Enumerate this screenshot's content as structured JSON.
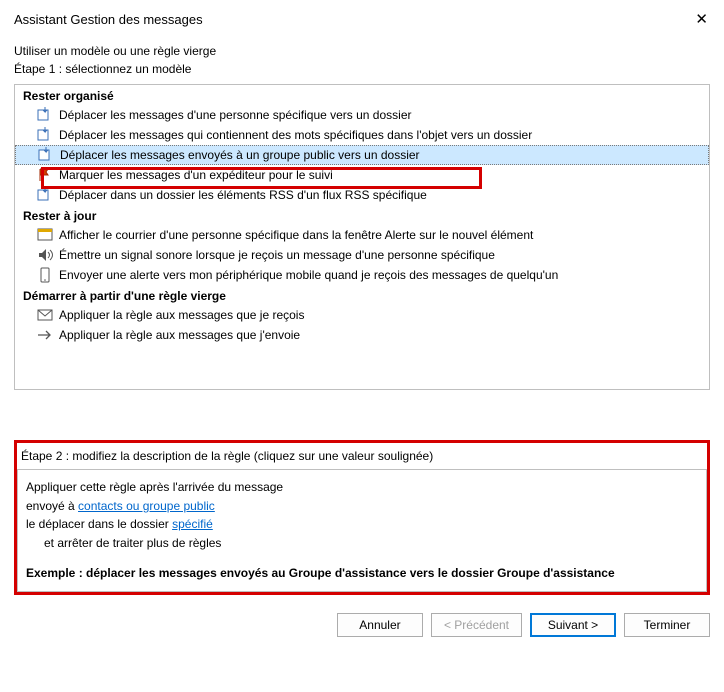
{
  "window": {
    "title": "Assistant Gestion des messages"
  },
  "intro": {
    "line1": "Utiliser un modèle ou une règle vierge",
    "line2": "Étape 1 : sélectionnez un modèle"
  },
  "sections": {
    "organised": {
      "title": "Rester organisé",
      "items": [
        "Déplacer les messages d'une personne spécifique vers un dossier",
        "Déplacer les messages qui contiennent des mots spécifiques dans l'objet vers un dossier",
        "Déplacer les messages envoyés à un groupe public vers un dossier",
        "Marquer les messages d'un expéditeur pour le suivi",
        "Déplacer dans un dossier les éléments RSS d'un flux RSS spécifique"
      ]
    },
    "up_to_date": {
      "title": "Rester à jour",
      "items": [
        "Afficher le courrier d'une personne spécifique dans la fenêtre Alerte sur le nouvel élément",
        "Émettre un signal sonore lorsque je reçois un message d'une personne spécifique",
        "Envoyer une alerte vers mon périphérique mobile quand je reçois des messages de quelqu'un"
      ]
    },
    "blank": {
      "title": "Démarrer à partir d'une règle vierge",
      "items": [
        "Appliquer la règle aux messages que je reçois",
        "Appliquer la règle aux messages que j'envoie"
      ]
    }
  },
  "step2": {
    "label": "Étape 2 : modifiez la description de la règle (cliquez sur une valeur soulignée)",
    "line1": "Appliquer cette règle après l'arrivée du message",
    "line2a": "envoyé à ",
    "line2link": "contacts ou groupe public",
    "line3a": "le déplacer dans le dossier ",
    "line3link": "spécifié",
    "line4": "et arrêter de traiter plus de règles",
    "example": "Exemple : déplacer les messages envoyés au Groupe d'assistance vers le dossier Groupe d'assistance"
  },
  "buttons": {
    "cancel": "Annuler",
    "back": "< Précédent",
    "next": "Suivant >",
    "finish": "Terminer"
  }
}
